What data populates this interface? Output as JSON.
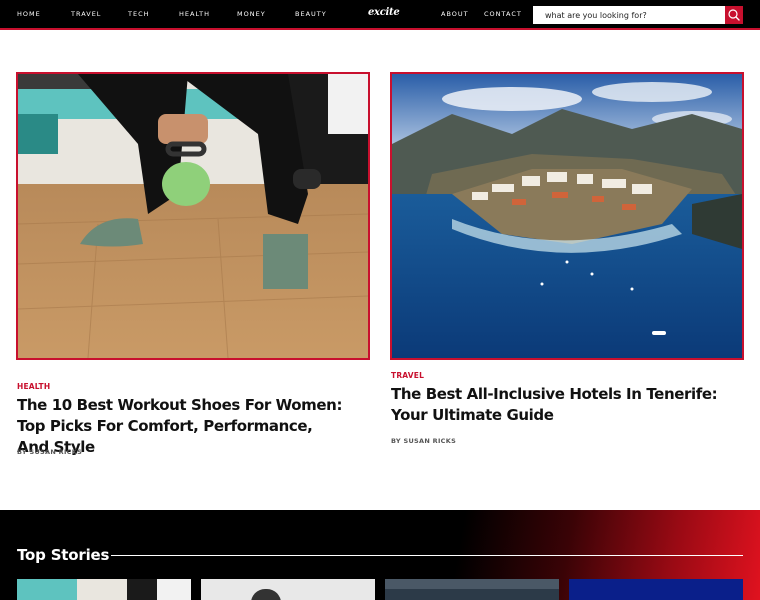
{
  "nav": {
    "left": [
      {
        "label": "HOME"
      },
      {
        "label": "TRAVEL"
      },
      {
        "label": "TECH"
      },
      {
        "label": "HEALTH"
      },
      {
        "label": "MONEY"
      },
      {
        "label": "BEAUTY"
      }
    ],
    "logo": "excite",
    "right": [
      {
        "label": "ABOUT"
      },
      {
        "label": "CONTACT"
      }
    ],
    "search": {
      "placeholder": "what are you looking for?"
    }
  },
  "articles": [
    {
      "category": "HEALTH",
      "title": "The 10 Best Workout Shoes For Women: Top Picks For Comfort, Performance, And Style",
      "byline": "BY SUSAN RICKS"
    },
    {
      "category": "TRAVEL",
      "title": "The Best All-Inclusive Hotels In Tenerife: Your Ultimate Guide",
      "byline": "BY SUSAN RICKS"
    }
  ],
  "top_stories": {
    "title": "Top Stories"
  },
  "colors": {
    "accent": "#c8102e",
    "nav_bg": "#000000",
    "text": "#111111"
  }
}
